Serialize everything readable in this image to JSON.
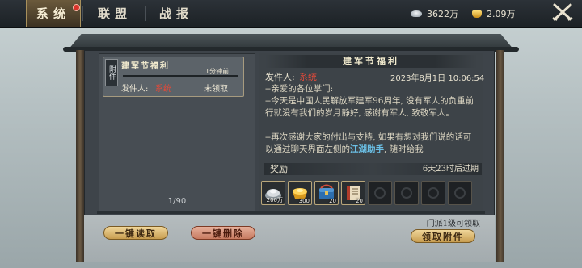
{
  "topbar": {
    "tabs": [
      {
        "label": "系统",
        "active": true
      },
      {
        "label": "联盟",
        "active": false
      },
      {
        "label": "战报",
        "active": false
      }
    ],
    "silver": "3622万",
    "gold": "2.09万",
    "silver_icon": "silver-ingot-icon",
    "gold_icon": "gold-ingot-icon",
    "menu_icon": "crossed-swords-icon"
  },
  "mail_list": {
    "items": [
      {
        "tag": "附件",
        "title": "建军节福利",
        "date": "1分钟前",
        "sender_label": "发件人:",
        "sender": "系统",
        "status": "未领取"
      }
    ],
    "count": "1/90"
  },
  "detail": {
    "title": "建军节福利",
    "sender_label": "发件人:",
    "sender": "系统",
    "datetime": "2023年8月1日 10:06:54",
    "body": [
      "--亲爱的各位掌门:",
      "--今天是中国人民解放军建军96周年, 没有军人的负重前行就没有我们的岁月静好, 感谢有军人, 致敬军人。",
      "",
      "--再次感谢大家的付出与支持, 如果有想对我们说的话可以通过聊天界面左侧的",
      "江湖助手",
      ", 随时给我"
    ],
    "reward_label": "奖励",
    "reward_timer": "6天23时后过期",
    "rewards": [
      {
        "icon": "silver-pile-icon",
        "qty": "200万"
      },
      {
        "icon": "gold-ingot-icon",
        "qty": "300"
      },
      {
        "icon": "blue-chest-icon",
        "qty": "20"
      },
      {
        "icon": "scroll-book-icon",
        "qty": "20"
      }
    ],
    "empty_slots": 4
  },
  "footer": {
    "read_all": "一键读取",
    "delete_all": "一键删除",
    "requirement": "门派1级可领取",
    "claim": "领取附件"
  },
  "colors": {
    "sender_red": "#e04a3a",
    "highlight_blue": "#6bc0e6",
    "gold_button": "#d9b46a",
    "red_button": "#d38f74"
  }
}
